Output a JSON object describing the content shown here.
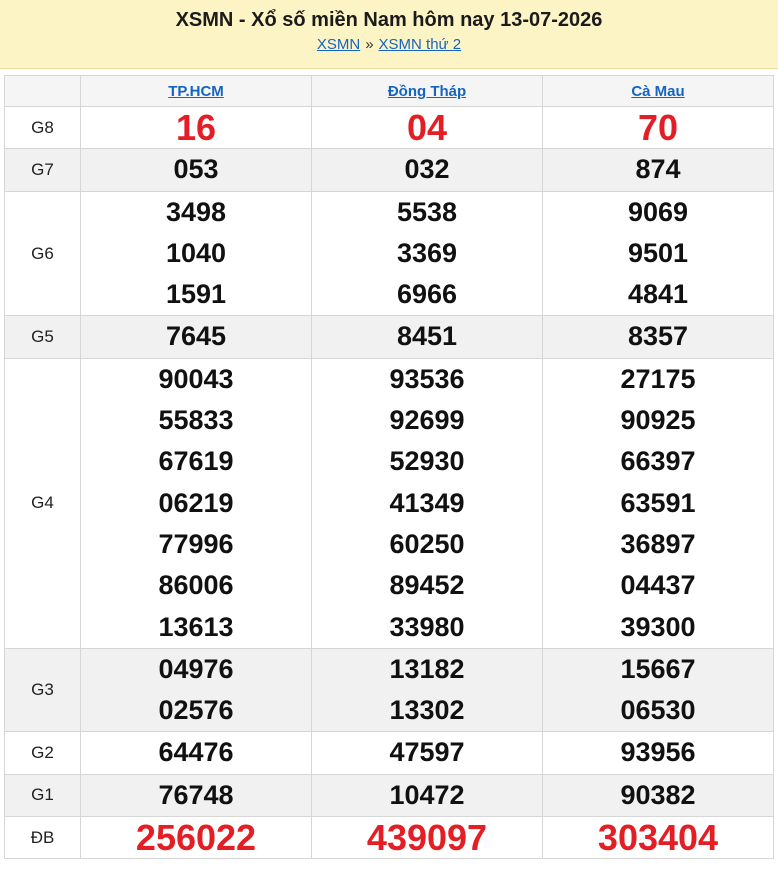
{
  "header": {
    "title": "XSMN - Xổ số miền Nam hôm nay 13-07-2026",
    "crumb1": "XSMN",
    "crumb_sep": "»",
    "crumb2": "XSMN thứ 2"
  },
  "provinces": [
    "TP.HCM",
    "Đồng Tháp",
    "Cà Mau"
  ],
  "prizes": {
    "g8": {
      "label": "G8",
      "values": [
        [
          "16"
        ],
        [
          "04"
        ],
        [
          "70"
        ]
      ]
    },
    "g7": {
      "label": "G7",
      "values": [
        [
          "053"
        ],
        [
          "032"
        ],
        [
          "874"
        ]
      ]
    },
    "g6": {
      "label": "G6",
      "values": [
        [
          "3498",
          "1040",
          "1591"
        ],
        [
          "5538",
          "3369",
          "6966"
        ],
        [
          "9069",
          "9501",
          "4841"
        ]
      ]
    },
    "g5": {
      "label": "G5",
      "values": [
        [
          "7645"
        ],
        [
          "8451"
        ],
        [
          "8357"
        ]
      ]
    },
    "g4": {
      "label": "G4",
      "values": [
        [
          "90043",
          "55833",
          "67619",
          "06219",
          "77996",
          "86006",
          "13613"
        ],
        [
          "93536",
          "92699",
          "52930",
          "41349",
          "60250",
          "89452",
          "33980"
        ],
        [
          "27175",
          "90925",
          "66397",
          "63591",
          "36897",
          "04437",
          "39300"
        ]
      ]
    },
    "g3": {
      "label": "G3",
      "values": [
        [
          "04976",
          "02576"
        ],
        [
          "13182",
          "13302"
        ],
        [
          "15667",
          "06530"
        ]
      ]
    },
    "g2": {
      "label": "G2",
      "values": [
        [
          "64476"
        ],
        [
          "47597"
        ],
        [
          "93956"
        ]
      ]
    },
    "g1": {
      "label": "G1",
      "values": [
        [
          "76748"
        ],
        [
          "10472"
        ],
        [
          "90382"
        ]
      ]
    },
    "db": {
      "label": "ĐB",
      "values": [
        [
          "256022"
        ],
        [
          "439097"
        ],
        [
          "303404"
        ]
      ]
    }
  }
}
